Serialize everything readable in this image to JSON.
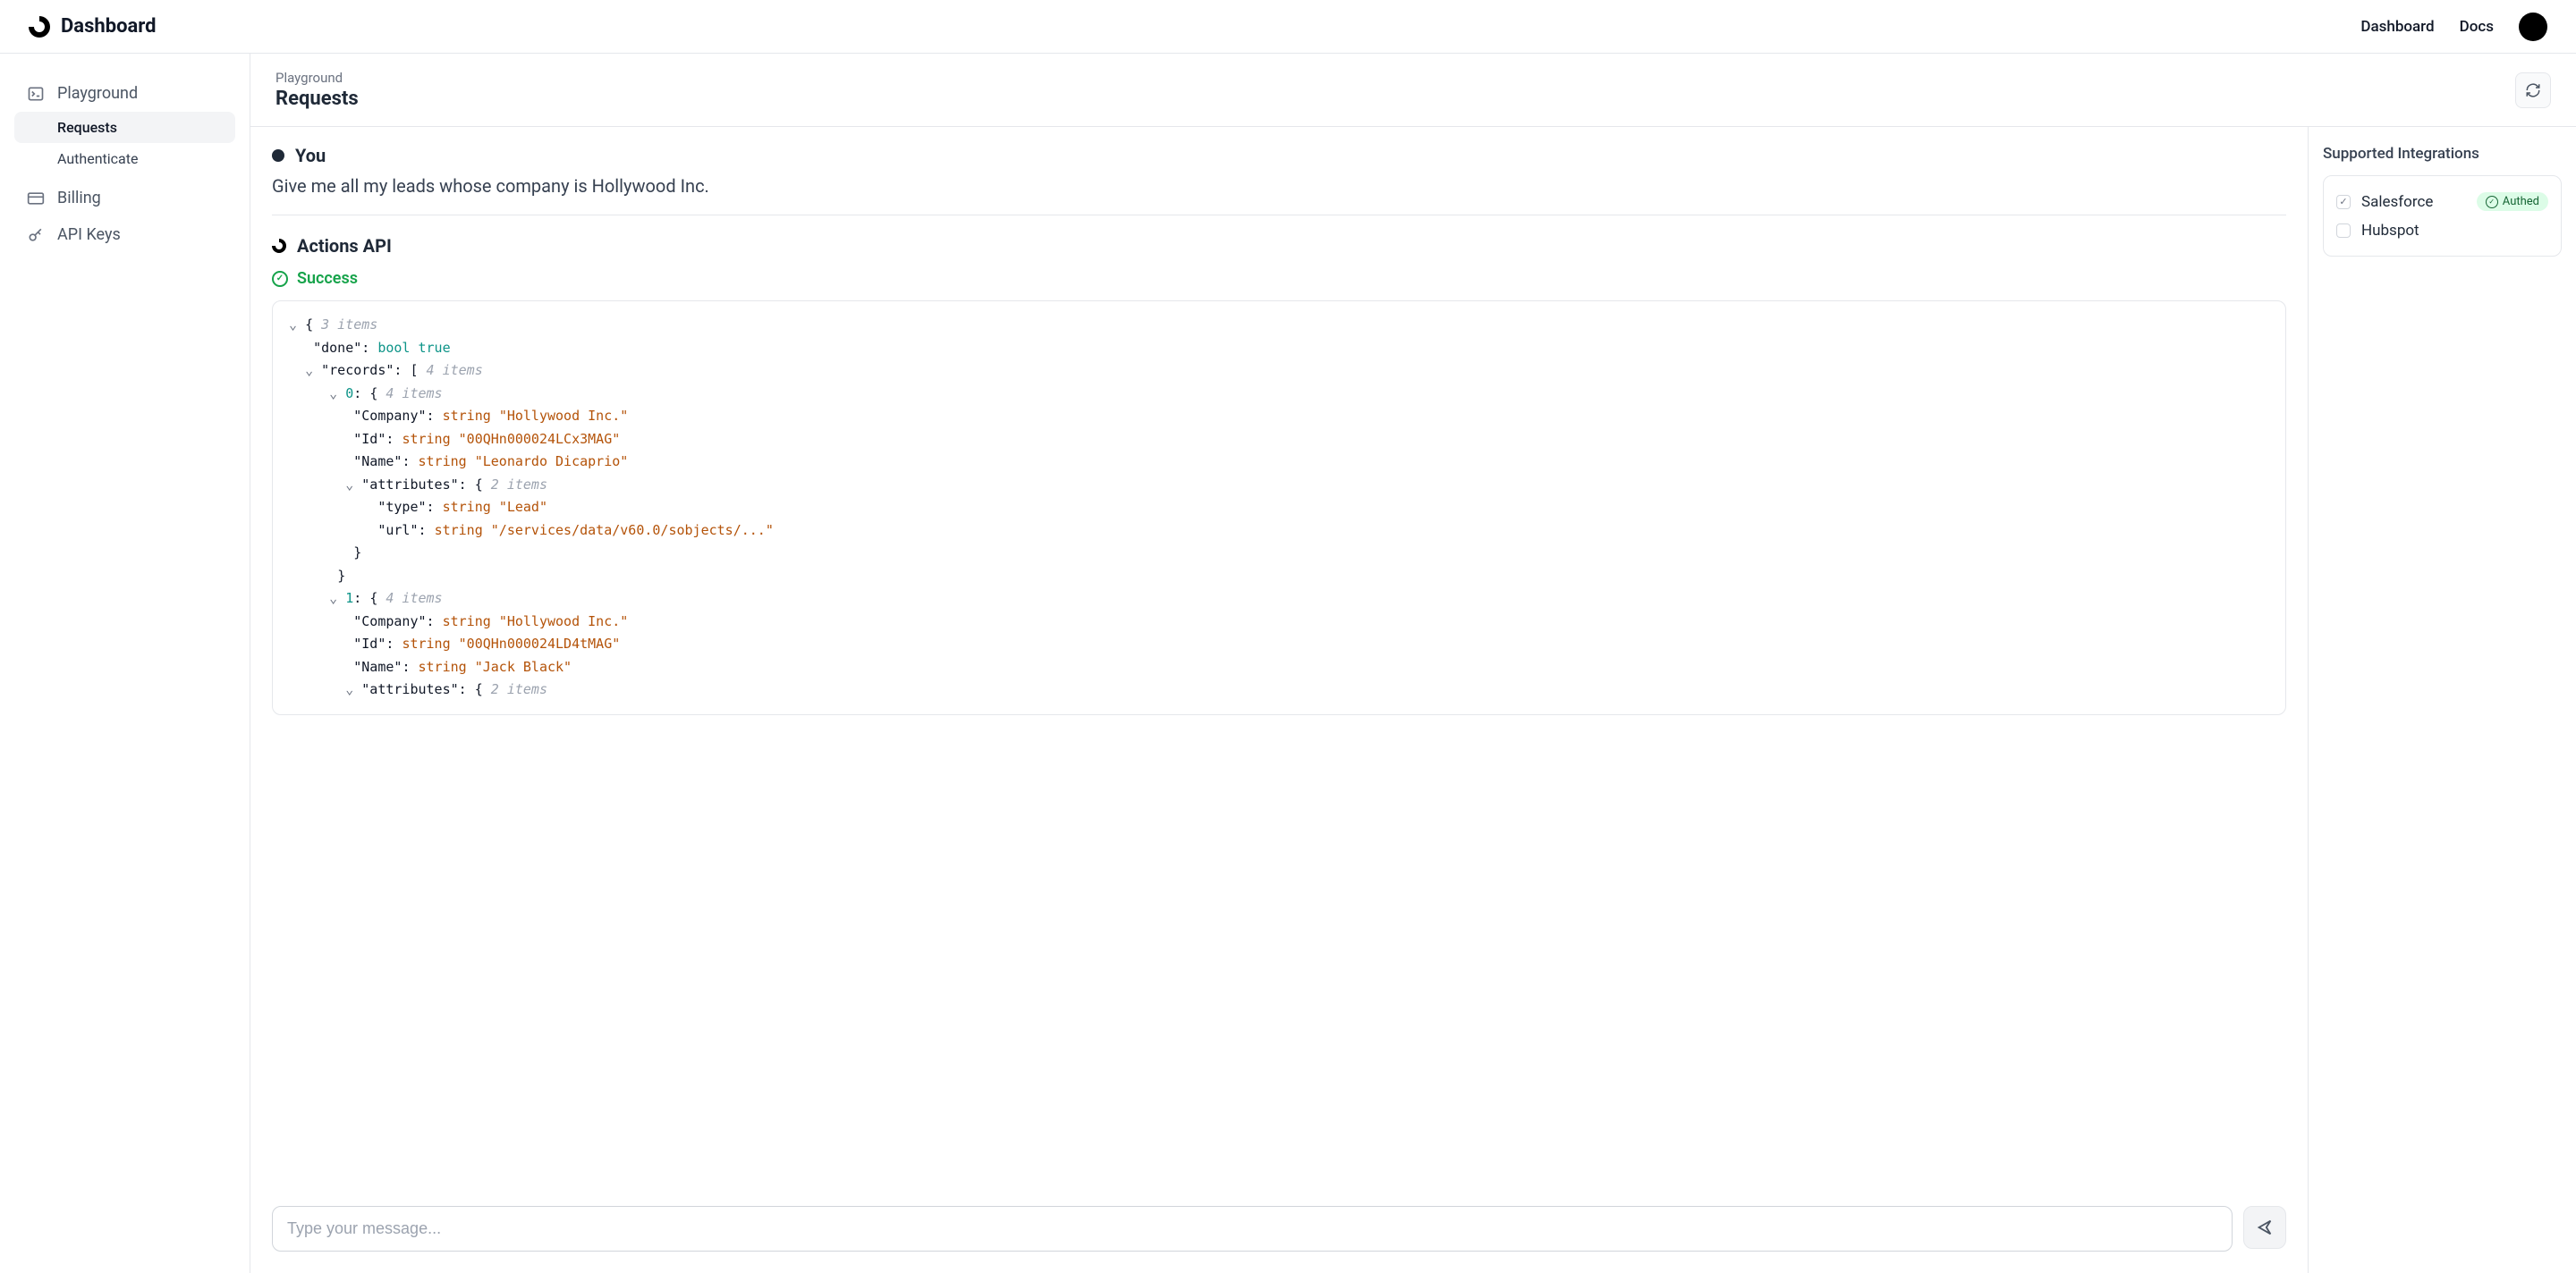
{
  "header": {
    "brand": "Dashboard",
    "nav": {
      "dashboard": "Dashboard",
      "docs": "Docs"
    }
  },
  "sidebar": {
    "playground": "Playground",
    "requests": "Requests",
    "authenticate": "Authenticate",
    "billing": "Billing",
    "api_keys": "API Keys"
  },
  "page": {
    "breadcrumb": "Playground",
    "title": "Requests"
  },
  "chat": {
    "you_label": "You",
    "user_message": "Give me all my leads whose company is Hollywood Inc.",
    "api_label": "Actions API",
    "status": "Success",
    "input_placeholder": "Type your message..."
  },
  "json_response": {
    "root_count": "3 items",
    "done_key": "\"done\"",
    "done_type": "bool",
    "done_val": "true",
    "records_key": "\"records\"",
    "records_count": "4 items",
    "rec0_idx": "0",
    "rec0_count": "4 items",
    "rec0_company_key": "\"Company\"",
    "rec0_company_val": "\"Hollywood Inc.\"",
    "rec0_id_key": "\"Id\"",
    "rec0_id_val": "\"00QHn000024LCx3MAG\"",
    "rec0_name_key": "\"Name\"",
    "rec0_name_val": "\"Leonardo Dicaprio\"",
    "rec0_attr_key": "\"attributes\"",
    "rec0_attr_count": "2 items",
    "rec0_attr_type_key": "\"type\"",
    "rec0_attr_type_val": "\"Lead\"",
    "rec0_attr_url_key": "\"url\"",
    "rec0_attr_url_val": "\"/services/data/v60.0/sobjects/...\"",
    "rec1_idx": "1",
    "rec1_count": "4 items",
    "rec1_company_key": "\"Company\"",
    "rec1_company_val": "\"Hollywood Inc.\"",
    "rec1_id_key": "\"Id\"",
    "rec1_id_val": "\"00QHn000024LD4tMAG\"",
    "rec1_name_key": "\"Name\"",
    "rec1_name_val": "\"Jack Black\"",
    "rec1_attr_key": "\"attributes\"",
    "rec1_attr_count": "2 items",
    "type_str": "string"
  },
  "right": {
    "title": "Supported Integrations",
    "salesforce": "Salesforce",
    "hubspot": "Hubspot",
    "authed": "Authed"
  }
}
